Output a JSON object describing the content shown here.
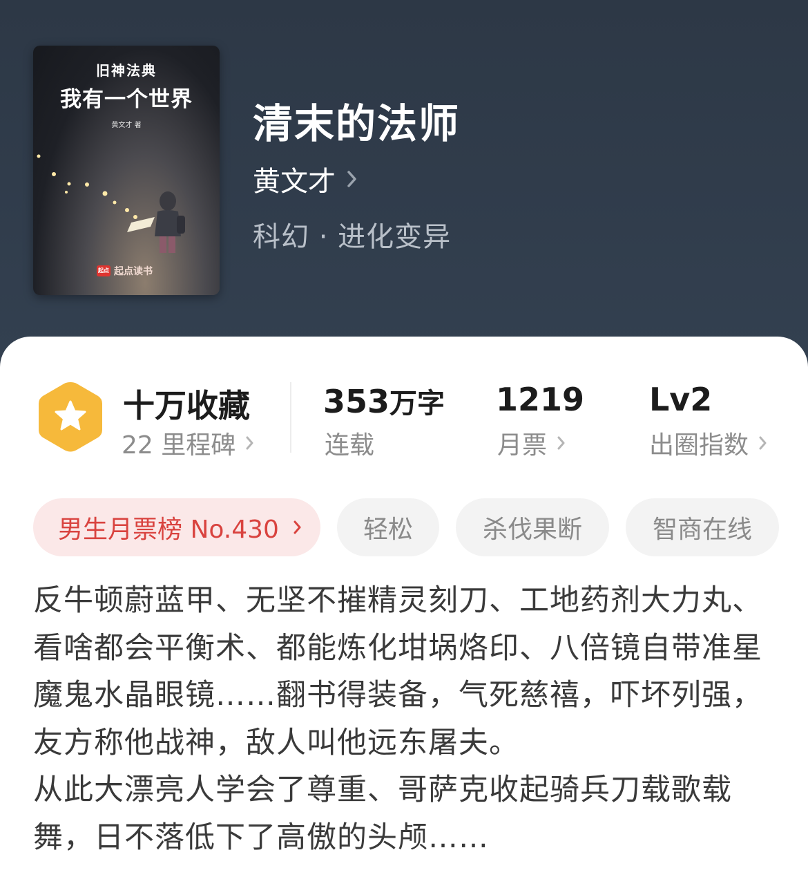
{
  "book": {
    "title": "清末的法师",
    "author": "黄文才",
    "genre": "科幻 · 进化变异"
  },
  "cover": {
    "series": "旧神法典",
    "title": "我有一个世界",
    "author": "黄文才 著",
    "publisher_logo": "起点",
    "publisher": "起点读书"
  },
  "stats": {
    "favorites": {
      "value": "十万收藏",
      "sub": "22 里程碑"
    },
    "words": {
      "value": "353",
      "unit": "万字",
      "sub": "连载"
    },
    "monthly_votes": {
      "value": "1219",
      "sub": "月票"
    },
    "popularity": {
      "value": "Lv2",
      "sub": "出圈指数"
    }
  },
  "tags": {
    "rank": "男生月票榜 No.430",
    "items": [
      "轻松",
      "杀伐果断",
      "智商在线"
    ]
  },
  "description": {
    "p1": "反牛顿蔚蓝甲、无坚不摧精灵刻刀、工地药剂大力丸、看啥都会平衡术、都能炼化坩埚烙印、八倍镜自带准星魔鬼水晶眼镜……翻书得装备，气死慈禧，吓坏列强，友方称他战神，敌人叫他远东屠夫。",
    "p2": "从此大漂亮人学会了尊重、哥萨克收起骑兵刀载歌载舞，日不落低下了高傲的头颅……"
  },
  "colors": {
    "header_bg": "#2f3a48",
    "badge": "#f6b93b",
    "rank_tag_bg": "#fbe8e8",
    "rank_tag_text": "#d9433f"
  }
}
